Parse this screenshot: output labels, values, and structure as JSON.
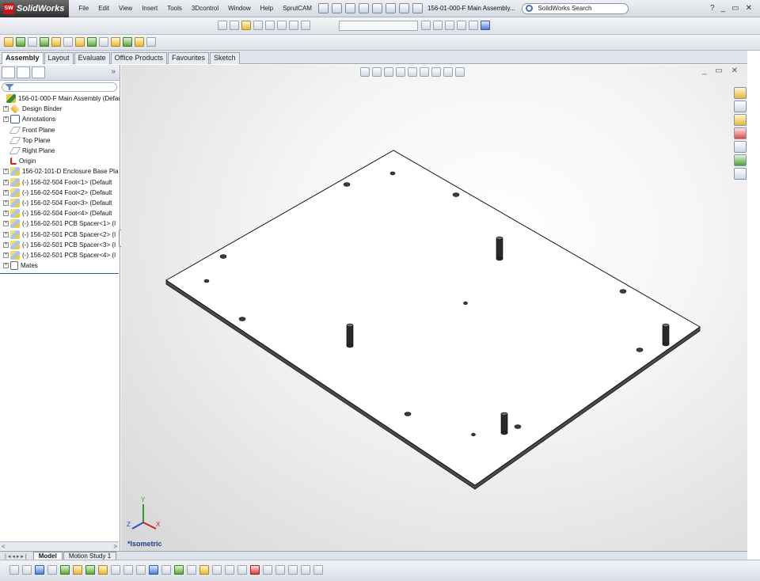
{
  "app": {
    "name": "SolidWorks",
    "logo_mark": "SW"
  },
  "menu": [
    "File",
    "Edit",
    "View",
    "Insert",
    "Tools",
    "3Dcontrol",
    "Window",
    "Help",
    "SprutCAM"
  ],
  "document_title": "156-01-000-F Main Assembly...",
  "search": {
    "label": "SolidWorks Search"
  },
  "window_controls": {
    "help": "?",
    "minimize": "_",
    "restore": "▭",
    "close": "✕"
  },
  "command_tabs": [
    {
      "label": "Assembly",
      "active": true
    },
    {
      "label": "Layout"
    },
    {
      "label": "Evaluate"
    },
    {
      "label": "Office Products"
    },
    {
      "label": "Favourites"
    },
    {
      "label": "Sketch"
    }
  ],
  "panel": {
    "more": "»"
  },
  "tree": {
    "root": "156-01-000-F Main Assembly  (Default",
    "items": [
      {
        "label": "Design Binder",
        "icon": "design-binder-icon",
        "expandable": true
      },
      {
        "label": "Annotations",
        "icon": "annotations-icon",
        "expandable": true
      },
      {
        "label": "Front Plane",
        "icon": "plane-icon",
        "expandable": false
      },
      {
        "label": "Top Plane",
        "icon": "plane-icon",
        "expandable": false
      },
      {
        "label": "Right Plane",
        "icon": "plane-icon",
        "expandable": false
      },
      {
        "label": "Origin",
        "icon": "origin-icon",
        "expandable": false
      },
      {
        "label": "156-02-101-D Enclosure Base Pla",
        "icon": "part-icon",
        "expandable": true
      },
      {
        "label": "(-) 156-02-504 Foot<1> (Default",
        "icon": "part-icon",
        "expandable": true
      },
      {
        "label": "(-) 156-02-504 Foot<2> (Default",
        "icon": "part-icon",
        "expandable": true
      },
      {
        "label": "(-) 156-02-504 Foot<3> (Default",
        "icon": "part-icon",
        "expandable": true
      },
      {
        "label": "(-) 156-02-504 Foot<4> (Default",
        "icon": "part-icon",
        "expandable": true
      },
      {
        "label": "(-) 156-02-501 PCB Spacer<1> (I",
        "icon": "part-icon",
        "expandable": true
      },
      {
        "label": "(-) 156-02-501 PCB Spacer<2> (I",
        "icon": "part-icon",
        "expandable": true
      },
      {
        "label": "(-) 156-02-501 PCB Spacer<3> (I",
        "icon": "part-icon",
        "expandable": true
      },
      {
        "label": "(-) 156-02-501 PCB Spacer<4> (I",
        "icon": "part-icon",
        "expandable": true
      },
      {
        "label": "Mates",
        "icon": "mates-icon",
        "expandable": true
      }
    ]
  },
  "viewport": {
    "view_label": "*Isometric",
    "triad": {
      "x": "X",
      "y": "Y",
      "z": "Z"
    }
  },
  "bottom_tabs": [
    {
      "label": "Model",
      "active": true
    },
    {
      "label": "Motion Study 1"
    }
  ],
  "colors": {
    "accent": "#2e5bb0",
    "logo_red": "#c8171b",
    "view_label": "#1f3f8a"
  }
}
